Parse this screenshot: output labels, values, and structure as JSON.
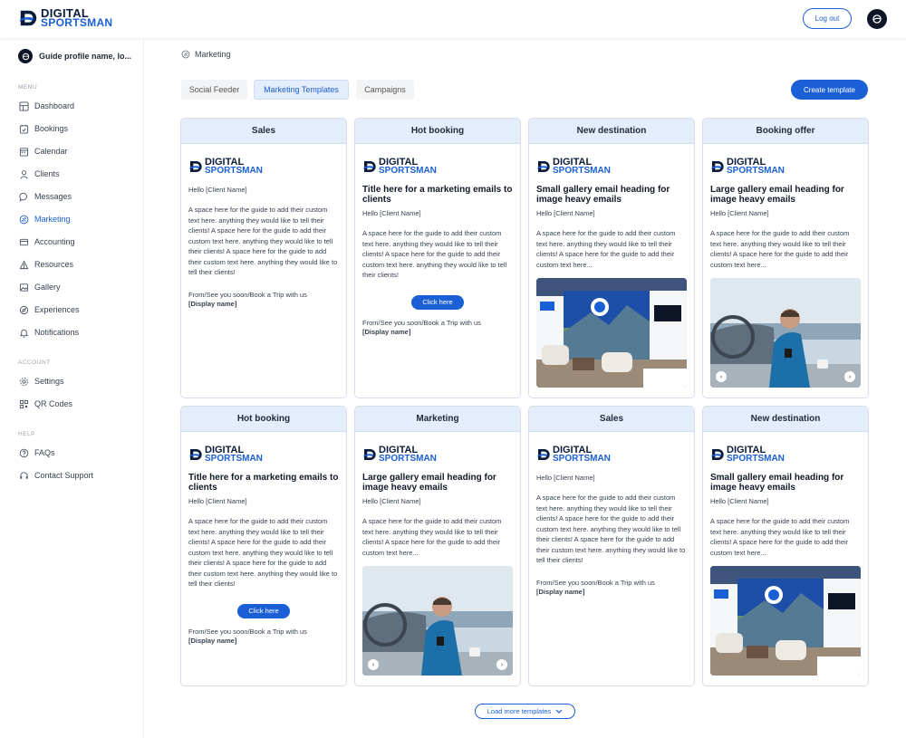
{
  "brand": {
    "line1": "DIGITAL",
    "line2": "SPORTSMAN"
  },
  "header": {
    "logout_label": "Log out"
  },
  "sidebar": {
    "profile_name": "Guide profile name, lo...",
    "menu_label": "MENU",
    "menu_items": [
      {
        "label": "Dashboard",
        "icon": "dashboard-icon"
      },
      {
        "label": "Bookings",
        "icon": "bookings-icon"
      },
      {
        "label": "Calendar",
        "icon": "calendar-icon"
      },
      {
        "label": "Clients",
        "icon": "clients-icon"
      },
      {
        "label": "Messages",
        "icon": "messages-icon"
      },
      {
        "label": "Marketing",
        "icon": "marketing-icon",
        "active": true
      },
      {
        "label": "Accounting",
        "icon": "accounting-icon"
      },
      {
        "label": "Resources",
        "icon": "resources-icon"
      },
      {
        "label": "Gallery",
        "icon": "gallery-icon"
      },
      {
        "label": "Experiences",
        "icon": "experiences-icon"
      },
      {
        "label": "Notifications",
        "icon": "bell-icon"
      }
    ],
    "account_label": "ACCOUNT",
    "account_items": [
      {
        "label": "Settings",
        "icon": "gear-icon"
      },
      {
        "label": "QR Codes",
        "icon": "qr-icon"
      }
    ],
    "help_label": "HELP",
    "help_items": [
      {
        "label": "FAQs",
        "icon": "question-icon"
      },
      {
        "label": "Contact Support",
        "icon": "headset-icon"
      }
    ]
  },
  "breadcrumb": {
    "label": "Marketing"
  },
  "tabs": [
    {
      "label": "Social Feeder"
    },
    {
      "label": "Marketing Templates",
      "active": true
    },
    {
      "label": "Campaigns"
    }
  ],
  "create_label": "Create template",
  "load_more_label": "Load more templates",
  "colors": {
    "accent": "#1b5fd6",
    "header_bg": "#e4edfb",
    "navy": "#0b1d3a"
  },
  "cards": {
    "c0": {
      "head": "Sales",
      "hello": "Hello [Client Name]",
      "text": "A space here for the guide to add their custom text here. anything they would like to tell their clients! A space here for the guide to add their custom text here. anything they would like to tell their clients! A space here for the guide to add their custom text here. anything they would like to tell their clients!",
      "sign": "From/See you soon/Book a Trip with us",
      "display": "[Display name]"
    },
    "c1": {
      "head": "Hot booking",
      "title": "Title here for a marketing emails to clients",
      "hello": "Hello [Client Name]",
      "text": "A space here for the guide to add their custom text here. anything they would like to tell their clients! A space here for the guide to add their custom text here. anything they would like to tell their clients!",
      "button": "Click here",
      "sign": "From/See you soon/Book a Trip with us",
      "display": "[Display name]"
    },
    "c2": {
      "head": "New destination",
      "title": "Small gallery email heading for image heavy emails",
      "hello": "Hello [Client Name]",
      "text": "A space here for the guide to add their custom text here. anything they would like to tell their clients! A space here for the guide to add their custom text here..."
    },
    "c3": {
      "head": "Booking offer",
      "title": "Large gallery email heading for image heavy emails",
      "hello": "Hello [Client Name]",
      "text": "A space here for the guide to add their custom text here. anything they would like to tell their clients! A space here for the guide to add their custom text here..."
    },
    "c4": {
      "head": "Hot booking",
      "title": "Title here for a marketing emails to clients",
      "hello": "Hello [Client Name]",
      "text": "A space here for the guide to add their custom text here. anything they would like to tell their clients! A space here for the guide to add their custom text here. anything they would like to tell their clients! A space here for the guide to add their custom text here. anything they would like to tell their clients!",
      "button": "Click here",
      "sign": "From/See you soon/Book a Trip with us",
      "display": "[Display name]"
    },
    "c5": {
      "head": "Marketing",
      "title": "Large gallery email heading for image heavy emails",
      "hello": "Hello [Client Name]",
      "text": "A space here for the guide to add their custom text here. anything they would like to tell their clients! A space here for the guide to add their custom text here..."
    },
    "c6": {
      "head": "Sales",
      "hello": "Hello [Client Name]",
      "text": "A space here for the guide to add their custom text here. anything they would like to tell their clients! A space here for the guide to add their custom text here. anything they would like to tell their clients! A space here for the guide to add their custom text here. anything they would like to tell their clients!",
      "sign": "From/See you soon/Book a Trip with us",
      "display": "[Display name]"
    },
    "c7": {
      "head": "New destination",
      "title": "Small gallery email heading for image heavy emails",
      "hello": "Hello [Client Name]",
      "text": "A space here for the guide to add their custom text here. anything they would like to tell their clients! A space here for the guide to add their custom text here..."
    }
  }
}
